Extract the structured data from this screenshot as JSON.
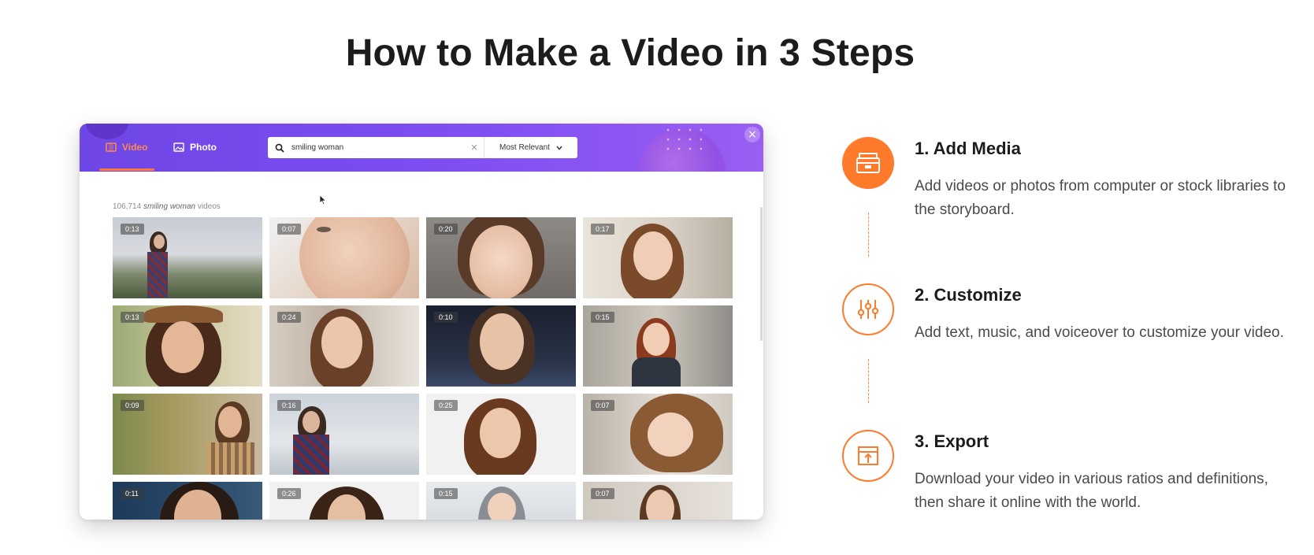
{
  "page": {
    "title": "How to Make a Video in 3 Steps"
  },
  "app": {
    "tabs": [
      {
        "label": "Video",
        "icon": "film-icon",
        "active": true
      },
      {
        "label": "Photo",
        "icon": "image-icon",
        "active": false
      }
    ],
    "search": {
      "value": "smiling woman",
      "sort": "Most Relevant"
    },
    "results": {
      "count": "106,714",
      "query": "smiling woman",
      "suffix": "videos"
    },
    "thumbnails": [
      {
        "duration": "0:13"
      },
      {
        "duration": "0:07"
      },
      {
        "duration": "0:20"
      },
      {
        "duration": "0:17"
      },
      {
        "duration": "0:13"
      },
      {
        "duration": "0:24"
      },
      {
        "duration": "0:10"
      },
      {
        "duration": "0:15"
      },
      {
        "duration": "0:09"
      },
      {
        "duration": "0:16"
      },
      {
        "duration": "0:25"
      },
      {
        "duration": "0:07"
      },
      {
        "duration": "0:11"
      },
      {
        "duration": "0:26"
      },
      {
        "duration": "0:15"
      },
      {
        "duration": "0:07"
      }
    ]
  },
  "steps": [
    {
      "title": "1. Add Media",
      "description": "Add videos or photos from computer or stock libraries to the storyboard.",
      "icon": "media-box-icon"
    },
    {
      "title": "2. Customize",
      "description": "Add text, music, and voiceover to customize your video.",
      "icon": "sliders-icon"
    },
    {
      "title": "3. Export",
      "description": "Download your video in various ratios and definitions, then share it online with the world.",
      "icon": "export-icon"
    }
  ],
  "colors": {
    "accent": "#ff7a2b",
    "header_start": "#6f47e6",
    "header_end": "#9a5ef2"
  }
}
